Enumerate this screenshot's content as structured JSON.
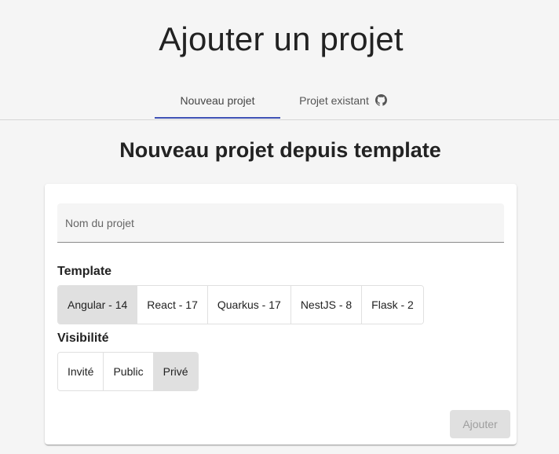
{
  "page": {
    "title": "Ajouter un projet"
  },
  "tabs": [
    {
      "label": "Nouveau projet",
      "active": true
    },
    {
      "label": "Projet existant",
      "icon": "github-icon",
      "active": false
    }
  ],
  "form": {
    "subtitle": "Nouveau projet depuis template",
    "name_placeholder": "Nom du projet",
    "template_label": "Template",
    "templates": [
      {
        "label": "Angular - 14",
        "selected": true
      },
      {
        "label": "React - 17",
        "selected": false
      },
      {
        "label": "Quarkus - 17",
        "selected": false
      },
      {
        "label": "NestJS - 8",
        "selected": false
      },
      {
        "label": "Flask - 2",
        "selected": false
      }
    ],
    "visibility_label": "Visibilité",
    "visibilities": [
      {
        "label": "Invité",
        "selected": false
      },
      {
        "label": "Public",
        "selected": false
      },
      {
        "label": "Privé",
        "selected": true
      }
    ],
    "submit_label": "Ajouter",
    "submit_disabled": true
  },
  "colors": {
    "accent": "#3f51b5",
    "selected_toggle": "#e0e0e0",
    "disabled_button": "#e0e0e0"
  }
}
